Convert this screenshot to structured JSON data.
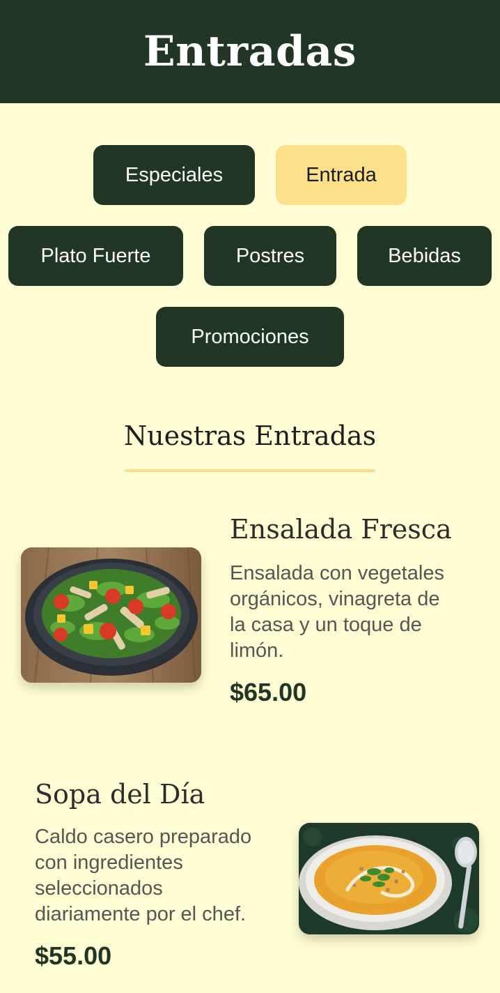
{
  "header": {
    "title": "Entradas"
  },
  "categories": [
    {
      "label": "Especiales",
      "active": false
    },
    {
      "label": "Entrada",
      "active": true
    },
    {
      "label": "Plato Fuerte",
      "active": false
    },
    {
      "label": "Postres",
      "active": false
    },
    {
      "label": "Bebidas",
      "active": false
    },
    {
      "label": "Promociones",
      "active": false
    }
  ],
  "section": {
    "title": "Nuestras Entradas"
  },
  "dishes": [
    {
      "name": "Ensalada Fresca",
      "desc_lines": [
        "Ensalada con vegetales",
        "orgánicos, vinagreta de",
        "la casa y un toque de",
        "limón."
      ],
      "price": "$65.00",
      "image": "salad-photo"
    },
    {
      "name": "Sopa del Día",
      "desc_lines": [
        "Caldo casero preparado",
        "con ingredientes",
        "seleccionados",
        "diariamente por el chef."
      ],
      "price": "$55.00",
      "image": "soup-photo"
    }
  ],
  "colors": {
    "primary": "#213624",
    "accent": "#FDE08A",
    "background": "#FEFDD3"
  }
}
